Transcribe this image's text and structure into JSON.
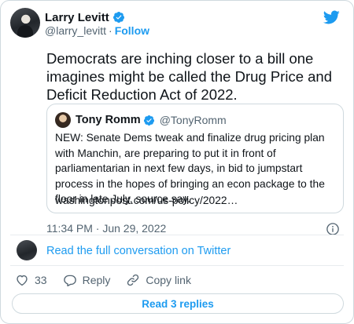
{
  "author": {
    "name": "Larry Levitt",
    "handle": "@larry_levitt",
    "separator": "·",
    "follow_label": "Follow"
  },
  "tweet": {
    "text": "Democrats are inching closer to a bill one imagines might be called the Drug Price and Deficit Reduction Act of 2022.",
    "timestamp": "11:34 PM · Jun 29, 2022"
  },
  "quote": {
    "name": "Tony Romm",
    "handle": "@TonyRomm",
    "text": "NEW: Senate Dems tweak and finalize drug pricing plan with Manchin, are preparing to put it in front of parliamentarian in next few days, in bid to jumpstart process in the hopes of bringing an econ package to the floor in late July, source say.",
    "link": "washingtonpost.com/us-policy/2022…"
  },
  "conversation_link": "Read the full conversation on Twitter",
  "actions": {
    "like_count": "33",
    "reply_label": "Reply",
    "copy_label": "Copy link"
  },
  "read_replies_label": "Read 3 replies",
  "colors": {
    "accent": "#1d9bf0",
    "text": "#0f1419",
    "muted": "#536471",
    "border": "#cfd9de"
  },
  "icons": [
    "verified-badge-icon",
    "twitter-bird-icon",
    "info-icon",
    "heart-icon",
    "reply-bubble-icon",
    "link-icon"
  ]
}
